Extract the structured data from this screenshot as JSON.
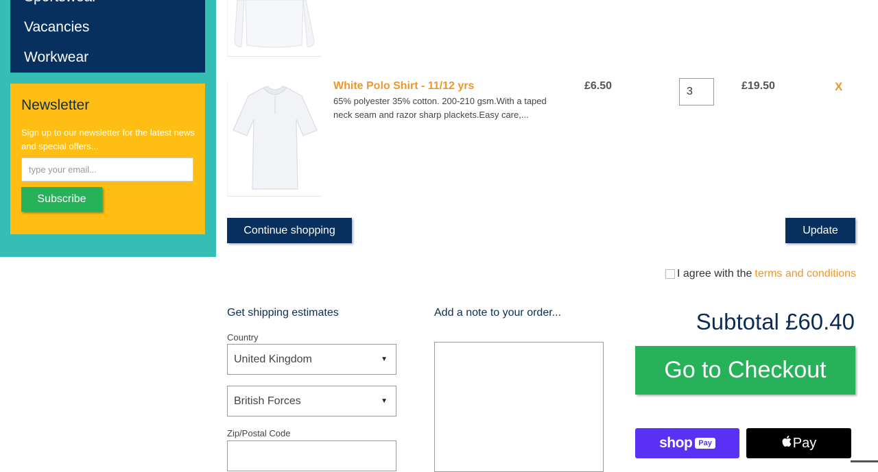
{
  "sidebar": {
    "nav": {
      "cut_label": "Sportswear",
      "items": [
        {
          "label": "Vacancies"
        },
        {
          "label": "Workwear"
        }
      ]
    },
    "newsletter": {
      "title": "Newsletter",
      "description": "Sign up to our newsletter for the latest news and special offers...",
      "email_placeholder": "type your email...",
      "subscribe_label": "Subscribe"
    }
  },
  "cart": {
    "items": [
      {
        "title": "White Polo Shirt - 11/12 yrs",
        "description": "65% polyester 35% cotton. 200-210 gsm.With a taped neck seam and razor sharp plackets.Easy care,...",
        "price": "£6.50",
        "quantity": "3",
        "line_total": "£19.50",
        "remove_label": "X"
      }
    ],
    "continue_label": "Continue shopping",
    "update_label": "Update",
    "agree_text": "I agree with the",
    "terms_link": "terms and conditions"
  },
  "shipping": {
    "title": "Get shipping estimates",
    "country_label": "Country",
    "country_value": "United Kingdom",
    "province_value": "British Forces",
    "zip_label": "Zip/Postal Code"
  },
  "note": {
    "title": "Add a note to your order..."
  },
  "checkout": {
    "subtotal": "Subtotal £60.40",
    "checkout_label": "Go to Checkout",
    "shop_pay_word": "shop",
    "shop_pay_badge": "Pay",
    "apple_pay_label": "Pay"
  },
  "colors": {
    "teal": "#35bfb4",
    "navy": "#07305f",
    "yellow": "#ffbe14",
    "green": "#27b259",
    "orange": "#f0962a",
    "shop_purple": "#5a31f4"
  }
}
